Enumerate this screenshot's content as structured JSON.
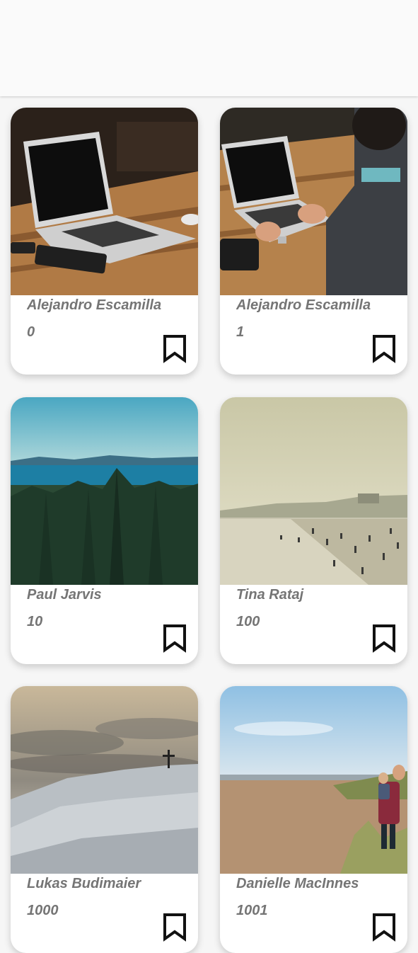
{
  "photos": [
    {
      "author": "Alejandro Escamilla",
      "id": "0"
    },
    {
      "author": "Alejandro Escamilla",
      "id": "1"
    },
    {
      "author": "Paul Jarvis",
      "id": "10"
    },
    {
      "author": "Tina Rataj",
      "id": "100"
    },
    {
      "author": "Lukas Budimaier",
      "id": "1000"
    },
    {
      "author": "Danielle MacInnes",
      "id": "1001"
    }
  ],
  "icons": {
    "save": "bookmark-outline-icon"
  },
  "colors": {
    "text": "#757575",
    "card": "#ffffff",
    "background": "#f6f6f6",
    "appbar": "#fafafa"
  }
}
